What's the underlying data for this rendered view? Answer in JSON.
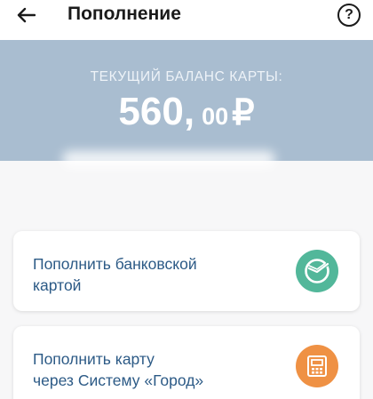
{
  "header": {
    "title": "Пополнение",
    "back_icon": "arrow-left-icon",
    "help_icon": "question-circle-icon",
    "help_glyph": "?"
  },
  "balance": {
    "label": "ТЕКУЩИЙ БАЛАНС КАРТЫ:",
    "integer": "560",
    "separator": ",",
    "decimal": "00",
    "currency": "₽",
    "background_color": "#a9bdd0"
  },
  "options": [
    {
      "line1": "Пополнить банковской",
      "line2": "картой",
      "icon": "sberbank-logo-icon",
      "icon_color": "#52b79a"
    },
    {
      "line1": "Пополнить карту",
      "line2": "через Систему «Город»",
      "icon": "gorod-payment-terminal-icon",
      "icon_color": "#ef9144"
    }
  ],
  "colors": {
    "link_text": "#2c5a86",
    "title_text": "#1b1b1b"
  }
}
